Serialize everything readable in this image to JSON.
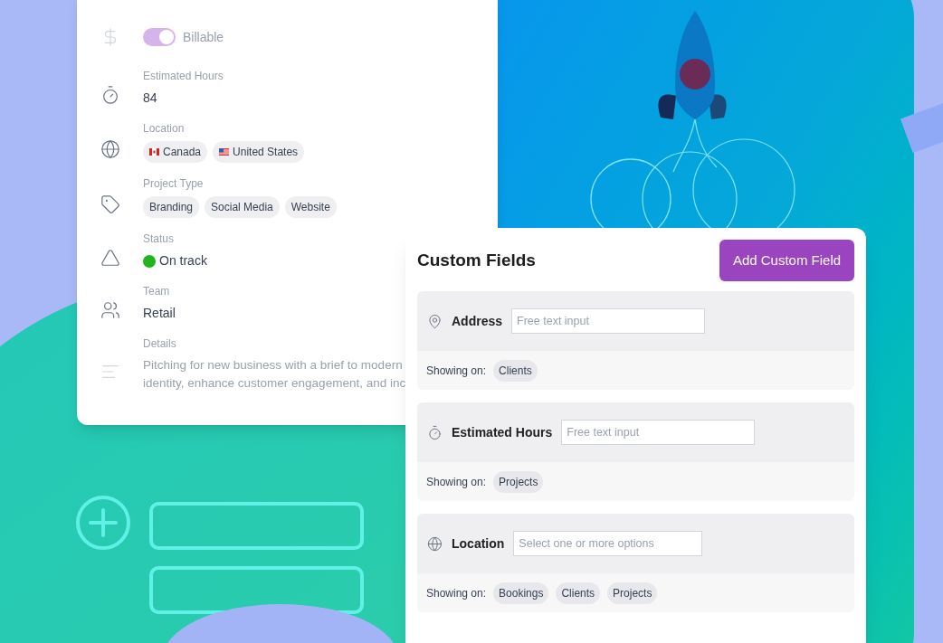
{
  "project_details": {
    "rows": [
      {
        "kind": "toggle",
        "label": "Billable",
        "on": true
      },
      {
        "kind": "text",
        "label": "Estimated Hours",
        "value": "84"
      },
      {
        "kind": "chips",
        "label": "Location",
        "chips": [
          {
            "text": "Canada",
            "kind": "ca"
          },
          {
            "text": "United States",
            "kind": "us"
          }
        ]
      },
      {
        "kind": "chips",
        "label": "Project Type",
        "chips": [
          {
            "text": "Branding",
            "kind": "plain"
          },
          {
            "text": "Social Media",
            "kind": "plain"
          },
          {
            "text": "Website",
            "kind": "plain"
          }
        ]
      },
      {
        "kind": "status",
        "label": "Status",
        "value": "On track",
        "color": "#22b41e"
      },
      {
        "kind": "text",
        "label": "Team",
        "value": "Retail"
      },
      {
        "kind": "paragraph",
        "label": "Details",
        "lines": [
          "Pitching for new business with a brief to modern",
          "identity, enhance customer engagement, and inc"
        ]
      }
    ]
  },
  "custom_fields": {
    "title": "Custom Fields",
    "add_button": "Add Custom Field",
    "fields": [
      {
        "kind": "text",
        "name": "Address",
        "placeholder": "Free text input",
        "showing_label": "Showing on:",
        "showing_on": [
          "Clients"
        ]
      },
      {
        "kind": "text",
        "name": "Estimated Hours",
        "placeholder": "Free text input",
        "showing_label": "Showing on:",
        "showing_on": [
          "Projects"
        ]
      },
      {
        "kind": "select",
        "name": "Location",
        "placeholder": "Select one or more options",
        "showing_label": "Showing on:",
        "showing_on": [
          "Bookings",
          "Clients",
          "Projects"
        ]
      }
    ]
  }
}
